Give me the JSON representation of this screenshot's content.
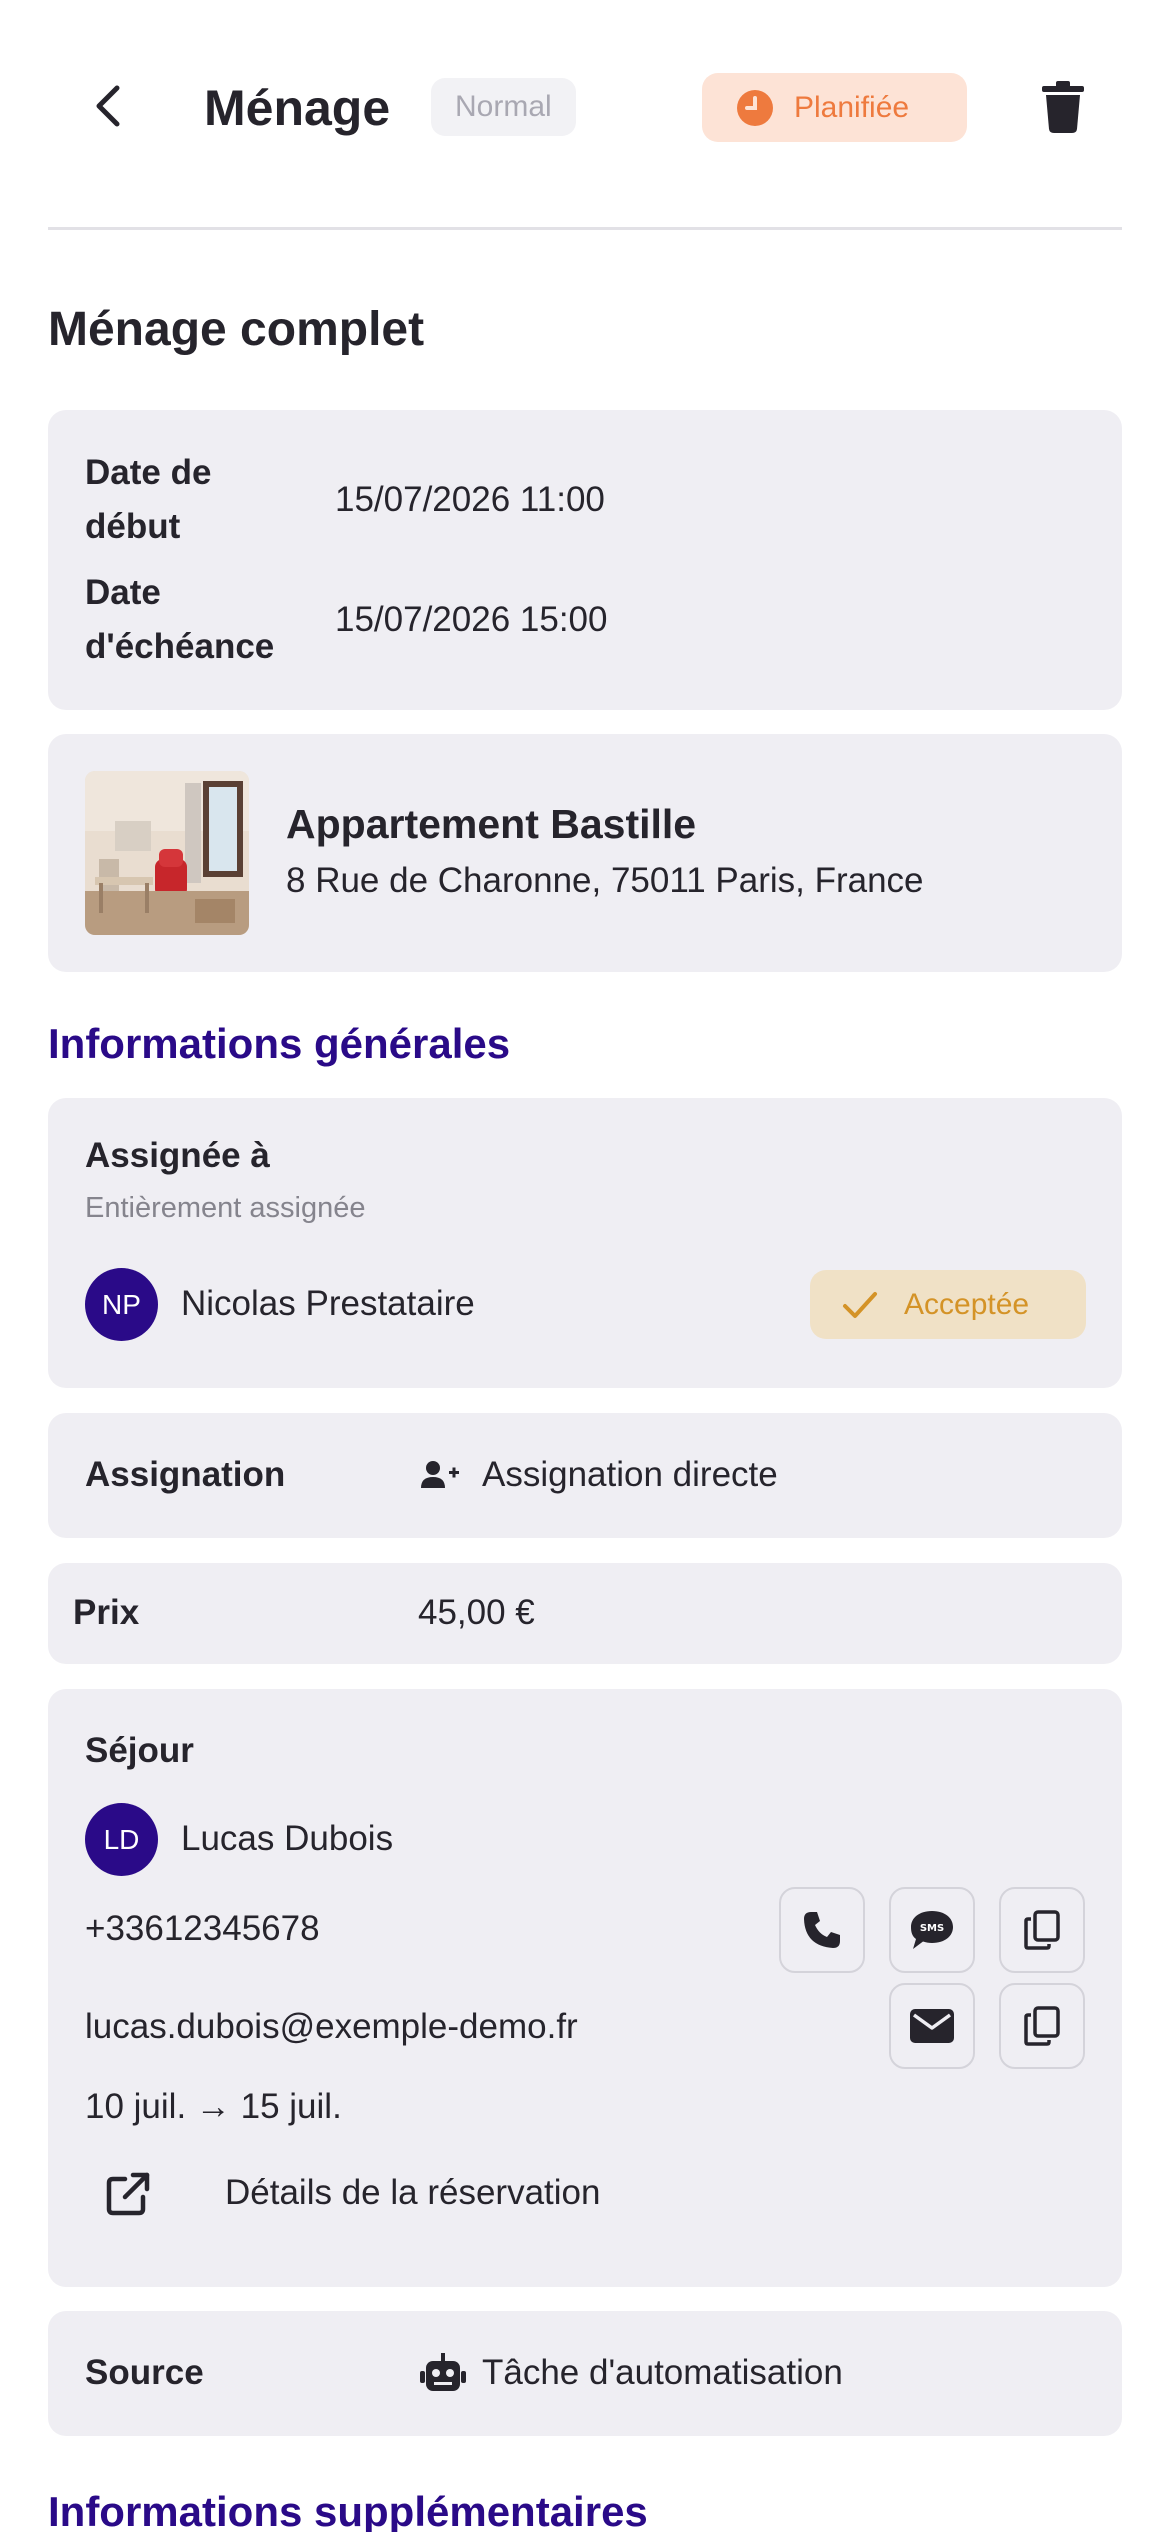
{
  "header": {
    "title": "Ménage",
    "priority": "Normal",
    "status": "Planifiée",
    "colors": {
      "status_bg": "#fde3d6",
      "status_text": "#ee7a3e",
      "priority_bg": "#f2f2f5",
      "priority_text": "#a9a8b2"
    }
  },
  "task": {
    "title": "Ménage complet"
  },
  "dates": {
    "start_label": "Date de début",
    "start_value": "15/07/2026 11:00",
    "due_label": "Date d'échéance",
    "due_value": "15/07/2026 15:00"
  },
  "property": {
    "name": "Appartement Bastille",
    "address": "8 Rue de Charonne, 75011 Paris, France"
  },
  "general_info": {
    "heading": "Informations générales",
    "assigned": {
      "label": "Assignée à",
      "sublabel": "Entièrement assignée",
      "assignee_initials": "NP",
      "assignee_name": "Nicolas Prestataire",
      "status": "Acceptée"
    },
    "assignment": {
      "label": "Assignation",
      "value": "Assignation directe",
      "icon": "user-plus-icon"
    },
    "price": {
      "label": "Prix",
      "value": "45,00 €"
    },
    "stay": {
      "label": "Séjour",
      "guest_initials": "LD",
      "guest_name": "Lucas Dubois",
      "phone": "+33612345678",
      "email": "lucas.dubois@exemple-demo.fr",
      "dates": "10 juil. → 15 juil.",
      "details_link": "Détails de la réservation"
    },
    "source": {
      "label": "Source",
      "value": "Tâche d'automatisation",
      "icon": "robot-icon"
    }
  },
  "extra_info": {
    "heading": "Informations supplémentaires"
  },
  "colors": {
    "accent": "#2a0a88",
    "card_bg": "#efeef3",
    "accepted_bg": "#f0e1c6",
    "accepted_text": "#d49327"
  }
}
